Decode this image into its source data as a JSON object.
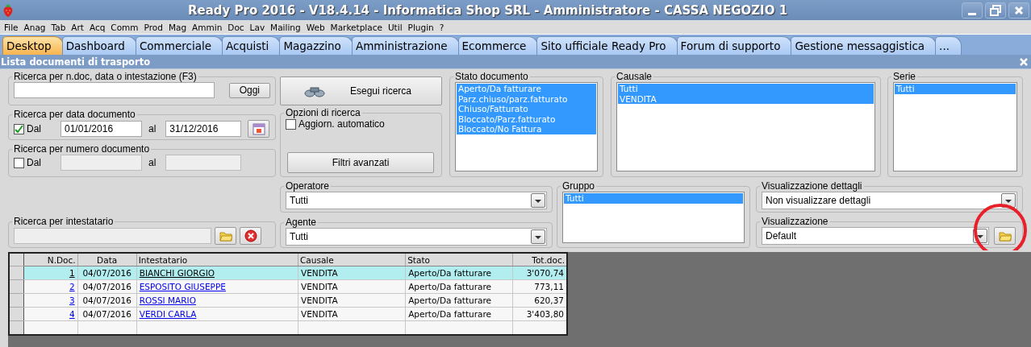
{
  "window": {
    "title": "Ready Pro 2016 - V18.4.14 - Informatica Shop SRL - Amministratore - CASSA NEGOZIO 1"
  },
  "menu": [
    "File",
    "Anag",
    "Tab",
    "Art",
    "Acq",
    "Comm",
    "Prod",
    "Mag",
    "Ammin",
    "Doc",
    "Lav",
    "Mailing",
    "Web",
    "Marketplace",
    "Util",
    "Plugin",
    "?"
  ],
  "tabs": [
    {
      "label": "Desktop",
      "selected": true
    },
    {
      "label": "Dashboard",
      "selected": false
    },
    {
      "label": "Commerciale",
      "selected": false
    },
    {
      "label": "Acquisti",
      "selected": false
    },
    {
      "label": "Magazzino",
      "selected": false
    },
    {
      "label": "Amministrazione",
      "selected": false
    },
    {
      "label": "Ecommerce",
      "selected": false
    },
    {
      "label": "Sito ufficiale Ready Pro",
      "selected": false
    },
    {
      "label": "Forum di supporto",
      "selected": false
    },
    {
      "label": "Gestione messaggistica",
      "selected": false
    },
    {
      "label": "...",
      "selected": false
    }
  ],
  "panel": {
    "title": "Lista documenti di trasporto"
  },
  "search": {
    "legend": "Ricerca per n.doc, data o intestazione (F3)",
    "button": "Oggi"
  },
  "date_range": {
    "legend": "Ricerca per data documento",
    "checkbox_label": "Dal",
    "checked": true,
    "from": "01/01/2016",
    "to_label": "al",
    "to": "31/12/2016",
    "disabled": false
  },
  "number_range": {
    "legend": "Ricerca per numero documento",
    "checkbox_label": "Dal",
    "checked": false,
    "to_label": "al",
    "disabled": true
  },
  "holder": {
    "legend": "Ricerca per intestatario",
    "disabled": true
  },
  "run_button": "Esegui ricerca",
  "options": {
    "legend": "Opzioni di ricerca",
    "auto_update": {
      "label": "Aggiorn. automatico",
      "checked": false
    },
    "advanced_button": "Filtri avanzati"
  },
  "status_list": {
    "legend": "Stato documento",
    "items": [
      {
        "label": "Aperto/Da fatturare",
        "selected": true
      },
      {
        "label": "Parz.chiuso/parz.fatturato",
        "selected": true
      },
      {
        "label": "Chiuso/Fatturato",
        "selected": true
      },
      {
        "label": "Bloccato/Parz.fatturato",
        "selected": true
      },
      {
        "label": "Bloccato/No Fattura",
        "selected": true
      }
    ]
  },
  "causale_list": {
    "legend": "Causale",
    "items": [
      {
        "label": "Tutti",
        "selected": true
      },
      {
        "label": "VENDITA",
        "selected": true
      }
    ]
  },
  "serie_list": {
    "legend": "Serie",
    "items": [
      {
        "label": "Tutti",
        "selected": true
      }
    ]
  },
  "operatore": {
    "legend": "Operatore",
    "value": "Tutti"
  },
  "agente": {
    "legend": "Agente",
    "value": "Tutti"
  },
  "gruppo_list": {
    "legend": "Gruppo",
    "items": [
      {
        "label": "Tutti",
        "selected": true
      }
    ]
  },
  "dettagli": {
    "legend": "Visualizzazione dettagli",
    "value": "Non visualizzare dettagli"
  },
  "visualizzazione": {
    "legend": "Visualizzazione",
    "value": "Default"
  },
  "table": {
    "columns": [
      "N.Doc.",
      "Data",
      "Intestatario",
      "Causale",
      "Stato",
      "Tot.doc."
    ],
    "rows": [
      {
        "selected": true,
        "cells": [
          "1",
          "04/07/2016",
          "BIANCHI GIORGIO",
          "VENDITA",
          "Aperto/Da fatturare",
          "3'070,74"
        ]
      },
      {
        "selected": false,
        "cells": [
          "2",
          "04/07/2016",
          "ESPOSITO GIUSEPPE",
          "VENDITA",
          "Aperto/Da fatturare",
          "773,11"
        ]
      },
      {
        "selected": false,
        "cells": [
          "3",
          "04/07/2016",
          "ROSSI MARIO",
          "VENDITA",
          "Aperto/Da fatturare",
          "620,37"
        ]
      },
      {
        "selected": false,
        "cells": [
          "4",
          "04/07/2016",
          "VERDI CARLA",
          "VENDITA",
          "Aperto/Da fatturare",
          "3'403,80"
        ]
      }
    ]
  }
}
